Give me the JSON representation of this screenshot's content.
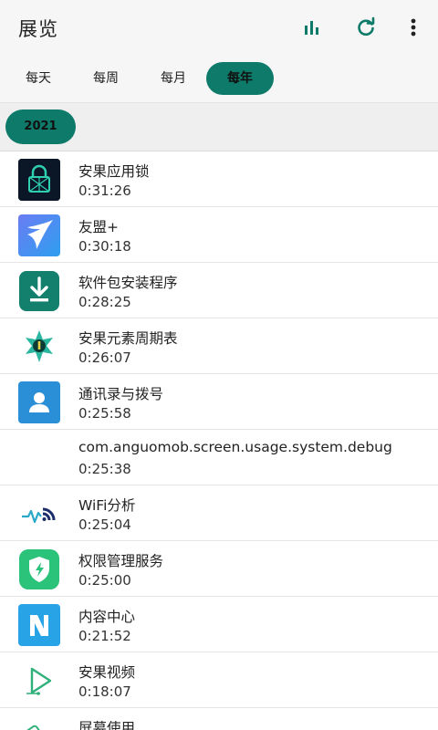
{
  "header": {
    "title": "展览",
    "actions": [
      "bar-chart-icon",
      "refresh-icon",
      "more-vert-icon"
    ]
  },
  "tabs": [
    {
      "label": "每天",
      "active": false
    },
    {
      "label": "每周",
      "active": false
    },
    {
      "label": "每月",
      "active": false
    },
    {
      "label": "每年",
      "active": true
    }
  ],
  "year_selector": {
    "selected": "2021"
  },
  "apps": [
    {
      "name": "安果应用锁",
      "time": "0:31:26",
      "icon": "app-lock-icon"
    },
    {
      "name": "友盟+",
      "time": "0:30:18",
      "icon": "umeng-icon"
    },
    {
      "name": "软件包安装程序",
      "time": "0:28:25",
      "icon": "package-installer-icon"
    },
    {
      "name": "安果元素周期表",
      "time": "0:26:07",
      "icon": "periodic-table-icon"
    },
    {
      "name": "通讯录与拨号",
      "time": "0:25:58",
      "icon": "contacts-icon"
    },
    {
      "name": "com.anguomob.screen.usage.system.debug",
      "time": "0:25:38",
      "icon": "blank-icon"
    },
    {
      "name": "WiFi分析",
      "time": "0:25:04",
      "icon": "wifi-analyzer-icon"
    },
    {
      "name": "权限管理服务",
      "time": "0:25:00",
      "icon": "permission-shield-icon"
    },
    {
      "name": "内容中心",
      "time": "0:21:52",
      "icon": "content-center-icon"
    },
    {
      "name": "安果视频",
      "time": "0:18:07",
      "icon": "video-play-icon"
    },
    {
      "name": "屏幕使用",
      "time": "",
      "icon": "screen-usage-icon"
    }
  ],
  "colors": {
    "accent": "#0e7a69",
    "topbar_bg": "#f6f6f6"
  }
}
